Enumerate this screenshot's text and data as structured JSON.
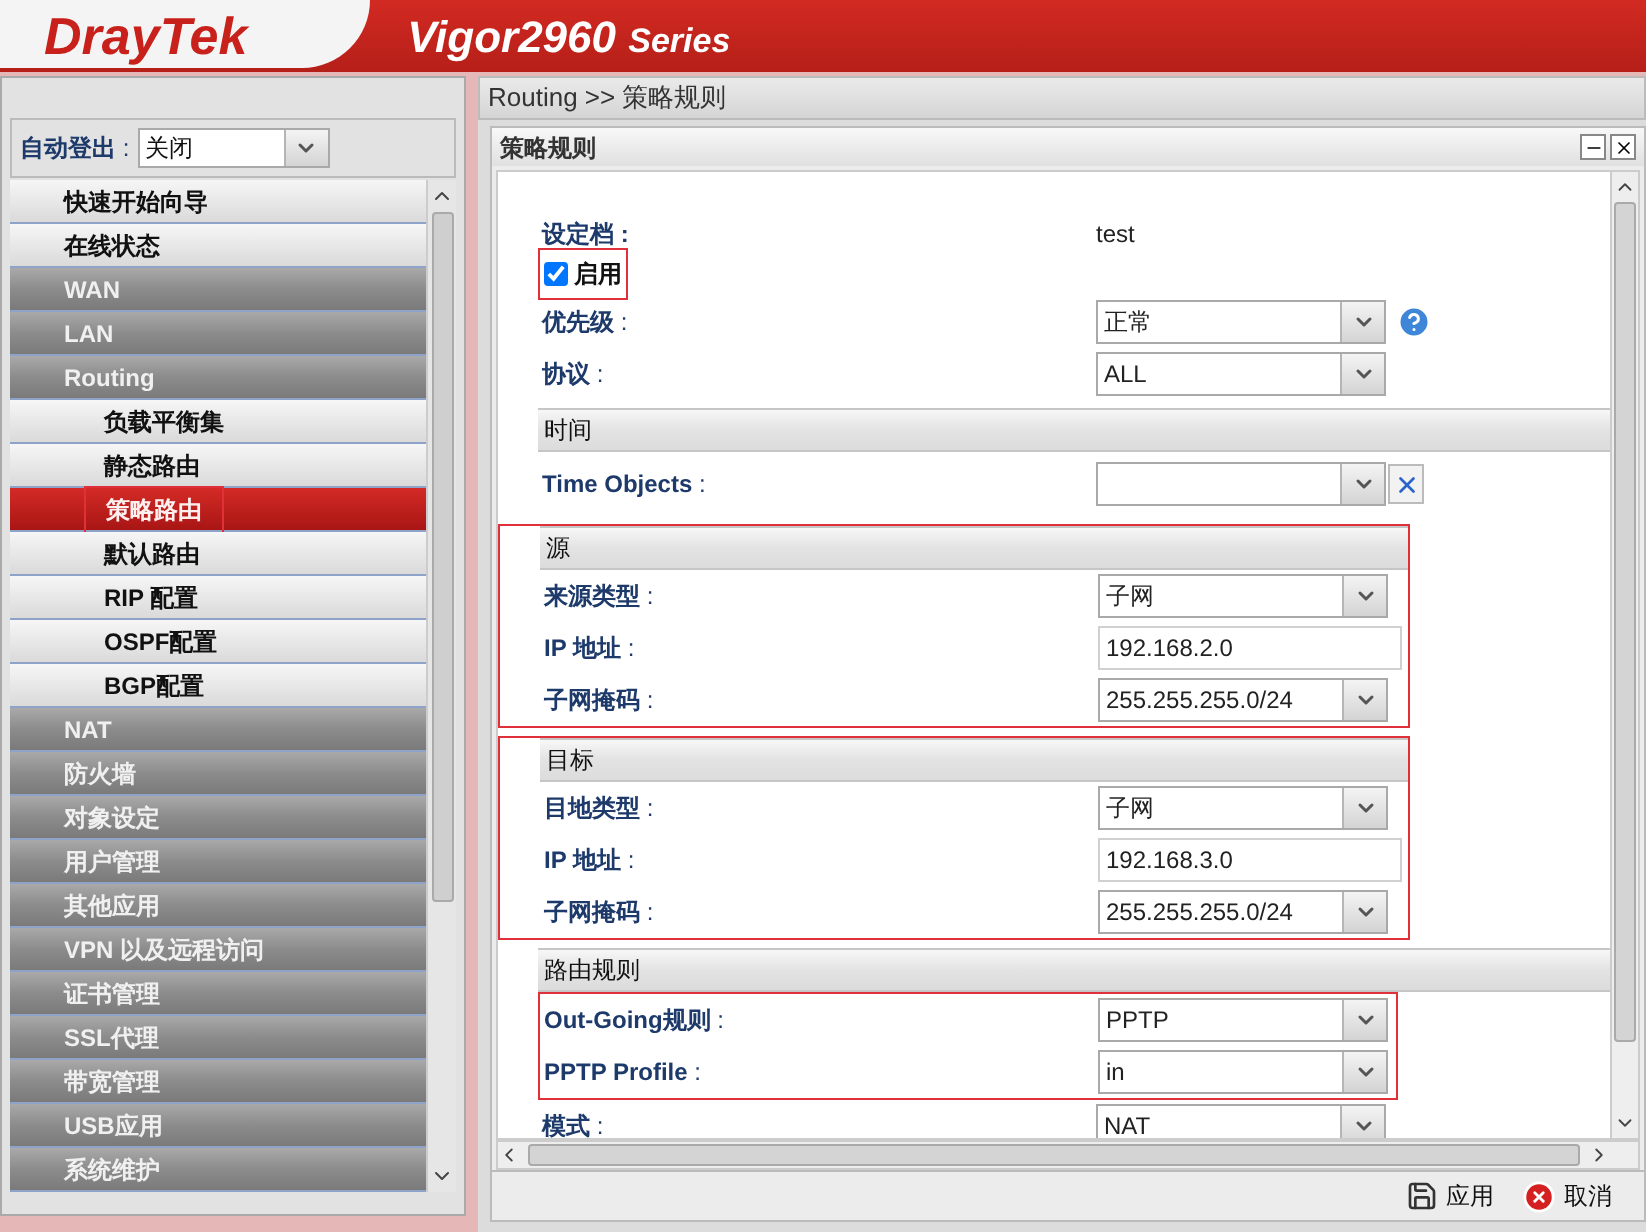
{
  "header": {
    "logo": "DrayTek",
    "model": "Vigor2960",
    "series": "Series"
  },
  "sidebar": {
    "auto_logout": {
      "label": "自动登出",
      "separator": ":",
      "value": "关闭"
    },
    "items": [
      {
        "label": "快速开始向导",
        "kind": "page",
        "selected": false
      },
      {
        "label": "在线状态",
        "kind": "page",
        "selected": false
      },
      {
        "label": "WAN",
        "kind": "group",
        "selected": false
      },
      {
        "label": "LAN",
        "kind": "group",
        "selected": false
      },
      {
        "label": "Routing",
        "kind": "group",
        "selected": false,
        "children": [
          {
            "label": "负载平衡集",
            "kind": "page",
            "selected": false
          },
          {
            "label": "静态路由",
            "kind": "page",
            "selected": false
          },
          {
            "label": "策略路由",
            "kind": "page",
            "selected": true,
            "highlighted": true
          },
          {
            "label": "默认路由",
            "kind": "page",
            "selected": false
          },
          {
            "label": "RIP 配置",
            "kind": "page",
            "selected": false
          },
          {
            "label": "OSPF配置",
            "kind": "page",
            "selected": false
          },
          {
            "label": "BGP配置",
            "kind": "page",
            "selected": false
          }
        ]
      },
      {
        "label": "NAT",
        "kind": "group",
        "selected": false
      },
      {
        "label": "防火墙",
        "kind": "group",
        "selected": false
      },
      {
        "label": "对象设定",
        "kind": "group",
        "selected": false
      },
      {
        "label": "用户管理",
        "kind": "group",
        "selected": false
      },
      {
        "label": "其他应用",
        "kind": "group",
        "selected": false
      },
      {
        "label": "VPN 以及远程访问",
        "kind": "group",
        "selected": false
      },
      {
        "label": "证书管理",
        "kind": "group",
        "selected": false
      },
      {
        "label": "SSL代理",
        "kind": "group",
        "selected": false
      },
      {
        "label": "带宽管理",
        "kind": "group",
        "selected": false
      },
      {
        "label": "USB应用",
        "kind": "group",
        "selected": false
      },
      {
        "label": "系统维护",
        "kind": "group",
        "selected": false
      }
    ]
  },
  "breadcrumb": "Routing >> 策略规则",
  "panel": {
    "title": "策略规则",
    "profile": {
      "label": "设定档 :",
      "value": "test"
    },
    "enable": {
      "label": "启用",
      "checked": true,
      "highlighted": true
    },
    "rows": [
      {
        "kind": "select",
        "label": "优先级",
        "separator": ":",
        "value": "正常",
        "help": true
      },
      {
        "kind": "select",
        "label": "协议",
        "separator": ":",
        "value": "ALL"
      }
    ],
    "sections": [
      {
        "title": "时间",
        "kind": "plain",
        "rows": [
          {
            "kind": "select",
            "label": "Time Objects",
            "separator": ":",
            "value": "",
            "clearable": true
          }
        ]
      },
      {
        "title": "源",
        "kind": "framed",
        "rows": [
          {
            "kind": "select",
            "label": "来源类型",
            "separator": ":",
            "value": "子网"
          },
          {
            "kind": "input",
            "label": "IP 地址",
            "separator": ":",
            "value": "192.168.2.0"
          },
          {
            "kind": "select",
            "label": "子网掩码",
            "separator": ":",
            "value": "255.255.255.0/24"
          }
        ]
      },
      {
        "title": "目标",
        "kind": "framed",
        "rows": [
          {
            "kind": "select",
            "label": "目地类型",
            "separator": ":",
            "value": "子网"
          },
          {
            "kind": "input",
            "label": "IP 地址",
            "separator": ":",
            "value": "192.168.3.0"
          },
          {
            "kind": "select",
            "label": "子网掩码",
            "separator": ":",
            "value": "255.255.255.0/24"
          }
        ]
      },
      {
        "title": "路由规则",
        "kind": "rowframed",
        "rows": [
          {
            "kind": "select",
            "label": "Out-Going规则",
            "separator": ":",
            "value": "PPTP"
          },
          {
            "kind": "select",
            "label": "PPTP Profile",
            "separator": ":",
            "value": "in"
          }
        ]
      }
    ],
    "trailing_rows": [
      {
        "kind": "select",
        "label": "模式",
        "separator": ":",
        "value": "NAT"
      }
    ],
    "buttons": [
      {
        "kind": "save",
        "label": "应用"
      },
      {
        "kind": "cancel",
        "label": "取消"
      }
    ]
  }
}
